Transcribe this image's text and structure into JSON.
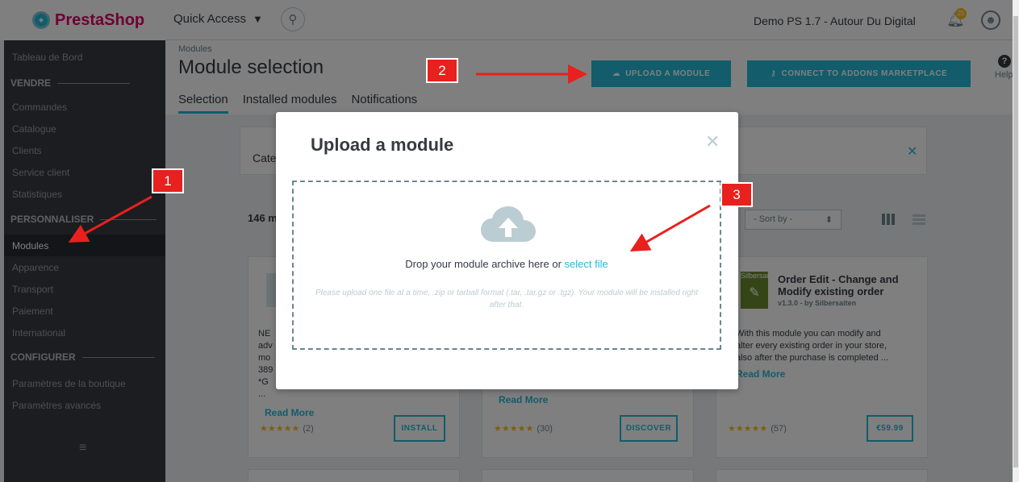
{
  "topbar": {
    "logo_text": "PrestaShop",
    "quick_access": "Quick Access",
    "shop_name": "Demo PS 1.7 - Autour Du Digital",
    "notif_count": "25"
  },
  "sidebar": {
    "items": [
      {
        "label": "Tableau de Bord"
      },
      {
        "label": "VENDRE"
      },
      {
        "label": "Commandes"
      },
      {
        "label": "Catalogue"
      },
      {
        "label": "Clients"
      },
      {
        "label": "Service client"
      },
      {
        "label": "Statistiques"
      },
      {
        "label": "PERSONNALISER"
      },
      {
        "label": "Modules"
      },
      {
        "label": "Apparence"
      },
      {
        "label": "Transport"
      },
      {
        "label": "Paiement"
      },
      {
        "label": "International"
      },
      {
        "label": "CONFIGURER"
      },
      {
        "label": "Paramètres de la boutique"
      },
      {
        "label": "Paramètres avancés"
      }
    ]
  },
  "header": {
    "breadcrumb": "Modules",
    "title": "Module selection",
    "tabs": [
      {
        "label": "Selection"
      },
      {
        "label": "Installed modules"
      },
      {
        "label": "Notifications"
      }
    ],
    "upload_label": "UPLOAD A MODULE",
    "connect_label": "CONNECT TO ADDONS MARKETPLACE",
    "help_label": "Help"
  },
  "content": {
    "filter_label": "Cate",
    "count_label": "146 m",
    "sort_label": "- Sort by -",
    "cards": [
      {
        "desc_lines": [
          "NE",
          "adv",
          "mo",
          "389",
          "*G",
          "..."
        ],
        "read_more": "Read More",
        "stars": "★★★★★",
        "rating_count": "(2)",
        "button": "INSTALL"
      },
      {
        "read_more": "Read More",
        "stars": "★★★★★",
        "rating_count": "(30)",
        "button": "DISCOVER"
      },
      {
        "title": "Order Edit - Change and Modify existing order",
        "version": "v1.3.0 - by",
        "author": "Silbersaiten",
        "img_label": "Silbersaiten",
        "desc_lines": [
          "With this module you can modify and",
          "alter every existing order in your store,",
          "also after the purchase is completed ..."
        ],
        "read_more": "Read More",
        "stars": "★★★★★",
        "rating_count": "(57)",
        "button": "€59.99"
      }
    ]
  },
  "modal": {
    "title": "Upload a module",
    "drop_text": "Drop your module archive here or ",
    "select_file": "select file",
    "note": "Please upload one file at a time, .zip or tarball format (.tar, .tar.gz or .tgz). Your module will be installed right after that."
  },
  "annotations": {
    "one": "1",
    "two": "2",
    "three": "3"
  },
  "colors": {
    "accent": "#25b9d7",
    "sidebar": "#363a41",
    "annotation": "#e8201e"
  }
}
